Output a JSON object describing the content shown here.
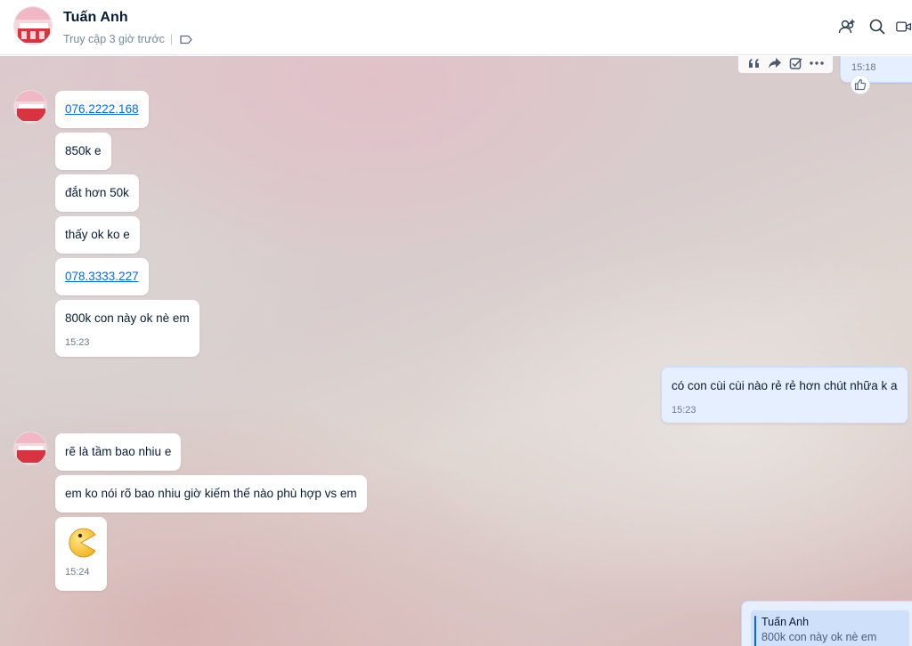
{
  "header": {
    "contact_name": "Tuấn Anh",
    "status": "Truy cập 3 giờ trước",
    "buttons": [
      "add-member-icon",
      "search-icon",
      "video-call-icon"
    ]
  },
  "chat": {
    "top_sent_time": "15:18",
    "toolbar_icons": [
      "quote-icon",
      "forward-icon",
      "select-icon",
      "more-icon"
    ],
    "group1": {
      "messages": [
        {
          "text": "076.2222.168",
          "link": true
        },
        {
          "text": "850k e"
        },
        {
          "text": "đắt hơn 50k"
        },
        {
          "text": "thấy ok ko e"
        },
        {
          "text": "078.3333.227",
          "link": true
        },
        {
          "text": "800k con này ok nè em",
          "time": "15:23"
        }
      ]
    },
    "sent1": {
      "text": "có con cùi cùi nào rẻ rẻ hơn chút nhữa k a",
      "time": "15:23"
    },
    "group2": {
      "messages": [
        {
          "text": "rẽ là tầm bao nhiu e"
        },
        {
          "text": "em ko nói rõ bao nhiu giờ kiếm thế nào phù hợp vs em"
        },
        {
          "emoji": "pacman-emoji",
          "time": "15:24"
        }
      ]
    },
    "sent2_quote": {
      "author": "Tuấn Anh",
      "text": "800k con này ok nè em"
    }
  },
  "colors": {
    "sent_bubble": "#e5efff",
    "received_bubble": "#ffffff",
    "link": "#0068ff",
    "text": "#081c36"
  }
}
